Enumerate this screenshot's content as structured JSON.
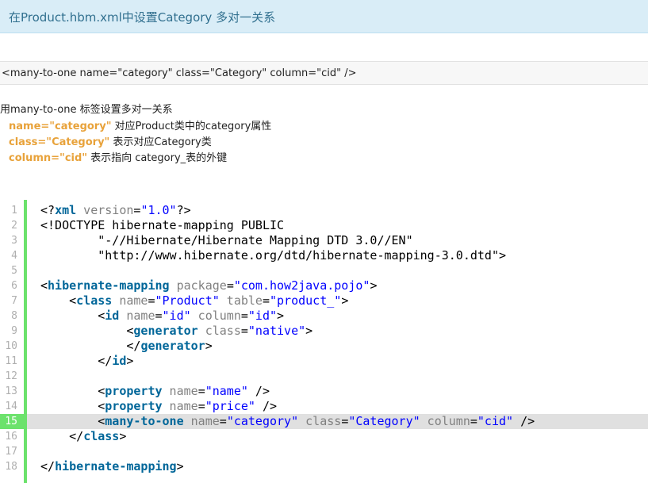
{
  "header": {
    "title": "在Product.hbm.xml中设置Category 多对一关系"
  },
  "snippet": {
    "code": "<many-to-one name=\"category\" class=\"Category\" column=\"cid\" />"
  },
  "description": {
    "intro": "使用many-to-one 标签设置多对一关系",
    "items": [
      {
        "attr": "name=\"category\"",
        "text": "对应Product类中的category属性"
      },
      {
        "attr": "class=\"Category\"",
        "text": "表示对应Category类"
      },
      {
        "attr": "column=\"cid\"",
        "text": "表示指向 category_表的外键"
      }
    ]
  },
  "editor": {
    "highlight_line": 15,
    "lines": [
      {
        "n": "1",
        "tokens": [
          [
            "plain",
            "<?"
          ],
          [
            "tag",
            "xml"
          ],
          [
            "attr",
            " version"
          ],
          [
            "plain",
            "="
          ],
          [
            "val",
            "\"1.0\""
          ],
          [
            "plain",
            "?>"
          ]
        ]
      },
      {
        "n": "2",
        "tokens": [
          [
            "plain",
            "<!DOCTYPE hibernate-mapping PUBLIC"
          ]
        ]
      },
      {
        "n": "3",
        "tokens": [
          [
            "plain",
            "        \"-//Hibernate/Hibernate Mapping DTD 3.0//EN\""
          ]
        ]
      },
      {
        "n": "4",
        "tokens": [
          [
            "plain",
            "        \"http://www.hibernate.org/dtd/hibernate-mapping-3.0.dtd\">"
          ]
        ]
      },
      {
        "n": "5",
        "tokens": []
      },
      {
        "n": "6",
        "tokens": [
          [
            "plain",
            "<"
          ],
          [
            "tag",
            "hibernate-mapping"
          ],
          [
            "attr",
            " package"
          ],
          [
            "plain",
            "="
          ],
          [
            "val",
            "\"com.how2java.pojo\""
          ],
          [
            "plain",
            ">"
          ]
        ]
      },
      {
        "n": "7",
        "tokens": [
          [
            "plain",
            "    <"
          ],
          [
            "tag",
            "class"
          ],
          [
            "attr",
            " name"
          ],
          [
            "plain",
            "="
          ],
          [
            "val",
            "\"Product\""
          ],
          [
            "attr",
            " table"
          ],
          [
            "plain",
            "="
          ],
          [
            "val",
            "\"product_\""
          ],
          [
            "plain",
            ">"
          ]
        ]
      },
      {
        "n": "8",
        "tokens": [
          [
            "plain",
            "        <"
          ],
          [
            "tag",
            "id"
          ],
          [
            "attr",
            " name"
          ],
          [
            "plain",
            "="
          ],
          [
            "val",
            "\"id\""
          ],
          [
            "attr",
            " column"
          ],
          [
            "plain",
            "="
          ],
          [
            "val",
            "\"id\""
          ],
          [
            "plain",
            ">"
          ]
        ]
      },
      {
        "n": "9",
        "tokens": [
          [
            "plain",
            "            <"
          ],
          [
            "tag",
            "generator"
          ],
          [
            "attr",
            " class"
          ],
          [
            "plain",
            "="
          ],
          [
            "val",
            "\"native\""
          ],
          [
            "plain",
            ">"
          ]
        ]
      },
      {
        "n": "10",
        "tokens": [
          [
            "plain",
            "            </"
          ],
          [
            "tag",
            "generator"
          ],
          [
            "plain",
            ">"
          ]
        ]
      },
      {
        "n": "11",
        "tokens": [
          [
            "plain",
            "        </"
          ],
          [
            "tag",
            "id"
          ],
          [
            "plain",
            ">"
          ]
        ]
      },
      {
        "n": "12",
        "tokens": []
      },
      {
        "n": "13",
        "tokens": [
          [
            "plain",
            "        <"
          ],
          [
            "tag",
            "property"
          ],
          [
            "attr",
            " name"
          ],
          [
            "plain",
            "="
          ],
          [
            "val",
            "\"name\""
          ],
          [
            "plain",
            " />"
          ]
        ]
      },
      {
        "n": "14",
        "tokens": [
          [
            "plain",
            "        <"
          ],
          [
            "tag",
            "property"
          ],
          [
            "attr",
            " name"
          ],
          [
            "plain",
            "="
          ],
          [
            "val",
            "\"price\""
          ],
          [
            "plain",
            " />"
          ]
        ]
      },
      {
        "n": "15",
        "tokens": [
          [
            "plain",
            "        <"
          ],
          [
            "tag",
            "many-to-one"
          ],
          [
            "attr",
            " name"
          ],
          [
            "plain",
            "="
          ],
          [
            "val",
            "\"category\""
          ],
          [
            "attr",
            " class"
          ],
          [
            "plain",
            "="
          ],
          [
            "val",
            "\"Category\""
          ],
          [
            "attr",
            " column"
          ],
          [
            "plain",
            "="
          ],
          [
            "val",
            "\"cid\""
          ],
          [
            "plain",
            " />"
          ]
        ]
      },
      {
        "n": "16",
        "tokens": [
          [
            "plain",
            "    </"
          ],
          [
            "tag",
            "class"
          ],
          [
            "plain",
            ">"
          ]
        ]
      },
      {
        "n": "17",
        "tokens": []
      },
      {
        "n": "18",
        "tokens": [
          [
            "plain",
            "</"
          ],
          [
            "tag",
            "hibernate-mapping"
          ],
          [
            "plain",
            ">"
          ]
        ]
      }
    ]
  }
}
